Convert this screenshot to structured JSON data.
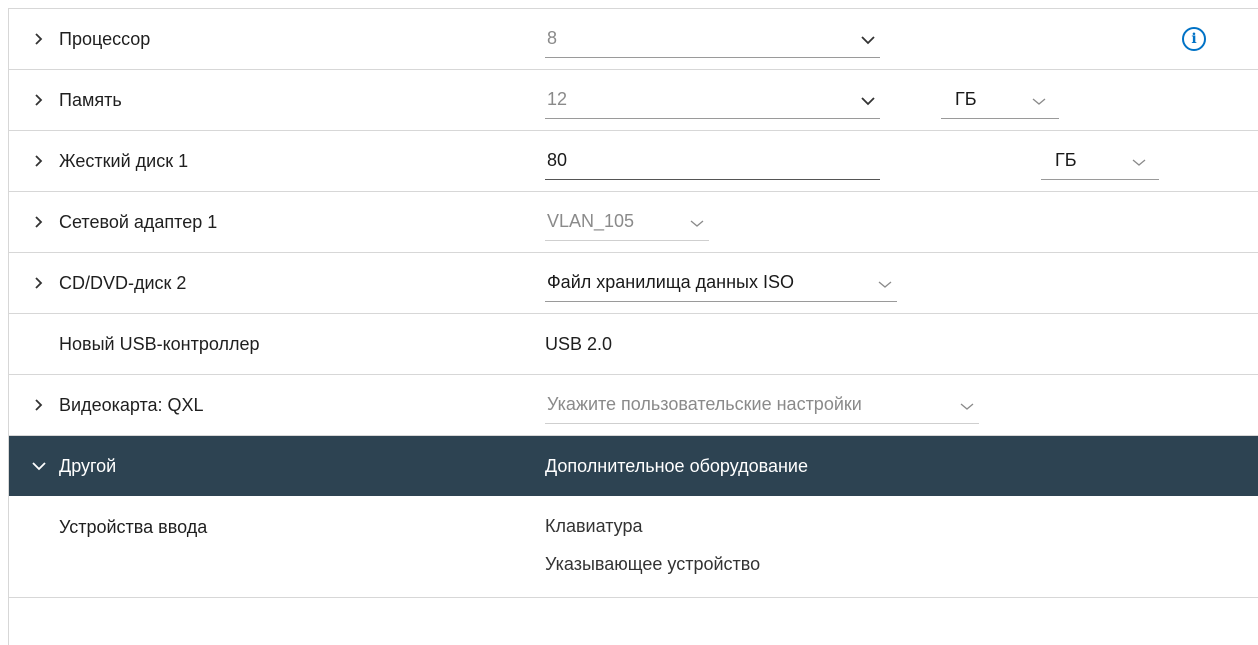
{
  "rows": {
    "cpu": {
      "label": "Процессор",
      "value": "8"
    },
    "memory": {
      "label": "Память",
      "value": "12",
      "unit": "ГБ"
    },
    "disk": {
      "label": "Жесткий диск 1",
      "value": "80",
      "unit": "ГБ"
    },
    "network": {
      "label": "Сетевой адаптер 1",
      "value": "VLAN_105"
    },
    "cddvd": {
      "label": "CD/DVD-диск 2",
      "value": "Файл хранилища данных ISO"
    },
    "usb": {
      "label": "Новый USB-контроллер",
      "value": "USB 2.0"
    },
    "video": {
      "label": "Видеокарта: QXL",
      "value": "Укажите пользовательские настройки"
    },
    "other": {
      "label": "Другой",
      "value": "Дополнительное оборудование"
    },
    "input": {
      "label": "Устройства ввода",
      "items": [
        "Клавиатура",
        "Указывающее устройство"
      ]
    }
  },
  "icons": {
    "expand": "chevron-right-icon",
    "collapse": "chevron-down-icon",
    "dropdown": "chevron-down-icon",
    "info": "info-icon"
  },
  "colors": {
    "accent": "#0072c6",
    "header_dark": "#2d4352",
    "border": "#d7d7d7"
  }
}
